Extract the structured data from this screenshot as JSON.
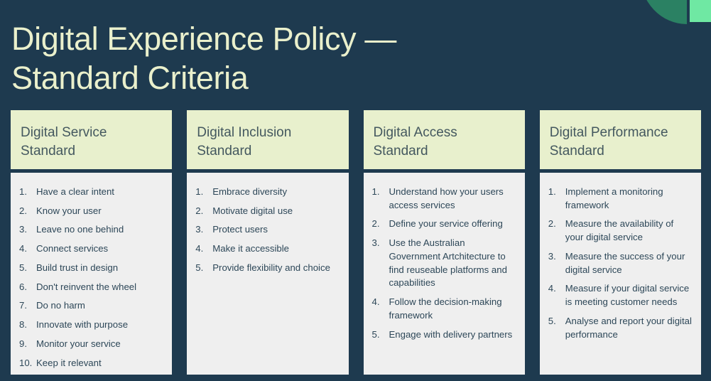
{
  "page": {
    "title": "Digital Experience Policy —\nStandard Criteria",
    "background_color": "#1e3a4f",
    "title_color": "#eaf0cc"
  },
  "decoration": {
    "arc_color": "#2b8163",
    "block_color": "#6fe8a3"
  },
  "cards": [
    {
      "header": "Digital Service\nStandard",
      "items": [
        {
          "num": "1.",
          "text": "Have a clear intent"
        },
        {
          "num": "2.",
          "text": "Know your user"
        },
        {
          "num": "3.",
          "text": "Leave no one behind"
        },
        {
          "num": "4.",
          "text": "Connect services"
        },
        {
          "num": "5.",
          "text": "Build trust in design"
        },
        {
          "num": "6.",
          "text": "Don't reinvent the wheel"
        },
        {
          "num": "7.",
          "text": "Do no harm"
        },
        {
          "num": "8.",
          "text": "Innovate with purpose"
        },
        {
          "num": "9.",
          "text": "Monitor your service"
        },
        {
          "num": "10.",
          "text": "Keep it relevant"
        }
      ]
    },
    {
      "header": "Digital Inclusion\nStandard",
      "items": [
        {
          "num": "1.",
          "text": "Embrace diversity"
        },
        {
          "num": "2.",
          "text": "Motivate digital use"
        },
        {
          "num": "3.",
          "text": "Protect users"
        },
        {
          "num": "4.",
          "text": "Make it accessible"
        },
        {
          "num": "5.",
          "text": "Provide flexibility and choice"
        }
      ]
    },
    {
      "header": "Digital Access\nStandard",
      "items": [
        {
          "num": "1.",
          "text": "Understand how your users access services"
        },
        {
          "num": "2.",
          "text": "Define your service offering"
        },
        {
          "num": "3.",
          "text": "Use the Australian Government Artchitecture to find reuseable platforms and capabilities"
        },
        {
          "num": "4.",
          "text": "Follow the decision-making framework"
        },
        {
          "num": "5.",
          "text": "Engage with delivery partners"
        }
      ]
    },
    {
      "header": "Digital Performance\nStandard",
      "items": [
        {
          "num": "1.",
          "text": "Implement a monitoring framework"
        },
        {
          "num": "2.",
          "text": "Measure the availability of your digital service"
        },
        {
          "num": "3.",
          "text": "Measure the success of your digital service"
        },
        {
          "num": "4.",
          "text": "Measure if your digital service is meeting customer needs"
        },
        {
          "num": "5.",
          "text": "Analyse and report your digital performance"
        }
      ]
    }
  ]
}
